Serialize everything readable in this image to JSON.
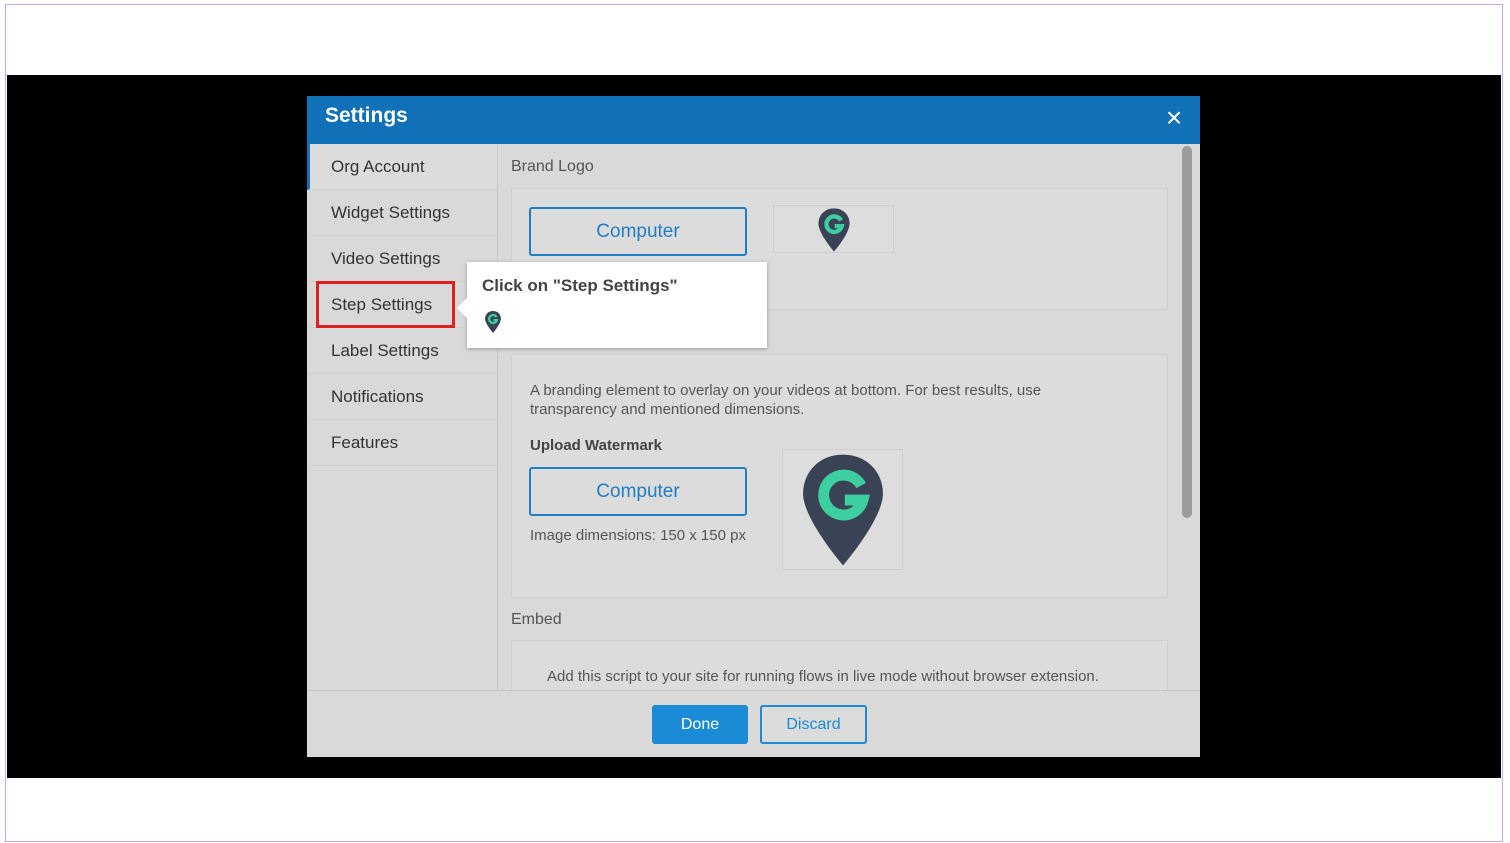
{
  "dialog": {
    "title": "Settings",
    "close_icon": "close-icon"
  },
  "sidebar": {
    "items": [
      {
        "label": "Org Account"
      },
      {
        "label": "Widget Settings"
      },
      {
        "label": "Video Settings"
      },
      {
        "label": "Step Settings"
      },
      {
        "label": "Label Settings"
      },
      {
        "label": "Notifications"
      },
      {
        "label": "Features"
      }
    ]
  },
  "content": {
    "brand_logo": {
      "label": "Brand Logo",
      "upload_button": "Computer",
      "preview_icon": "guide-pin-logo-icon"
    },
    "watermark": {
      "description": "A branding element to overlay on your videos at bottom. For best results, use transparency and mentioned dimensions.",
      "upload_label": "Upload Watermark",
      "upload_button": "Computer",
      "dimensions": "Image dimensions: 150 x 150 px",
      "preview_icon": "guide-pin-logo-icon"
    },
    "embed": {
      "label": "Embed",
      "description": "Add this script to your site for running flows in live mode without browser extension."
    }
  },
  "footer": {
    "done_label": "Done",
    "discard_label": "Discard"
  },
  "tooltip": {
    "text": "Click on \"Step Settings\"",
    "icon": "guide-pin-logo-icon"
  },
  "colors": {
    "titlebar": "#1070b8",
    "accent": "#1a8bd4",
    "highlight": "#e02020",
    "logo_dark": "#3a4255",
    "logo_green": "#3ecfa0"
  }
}
